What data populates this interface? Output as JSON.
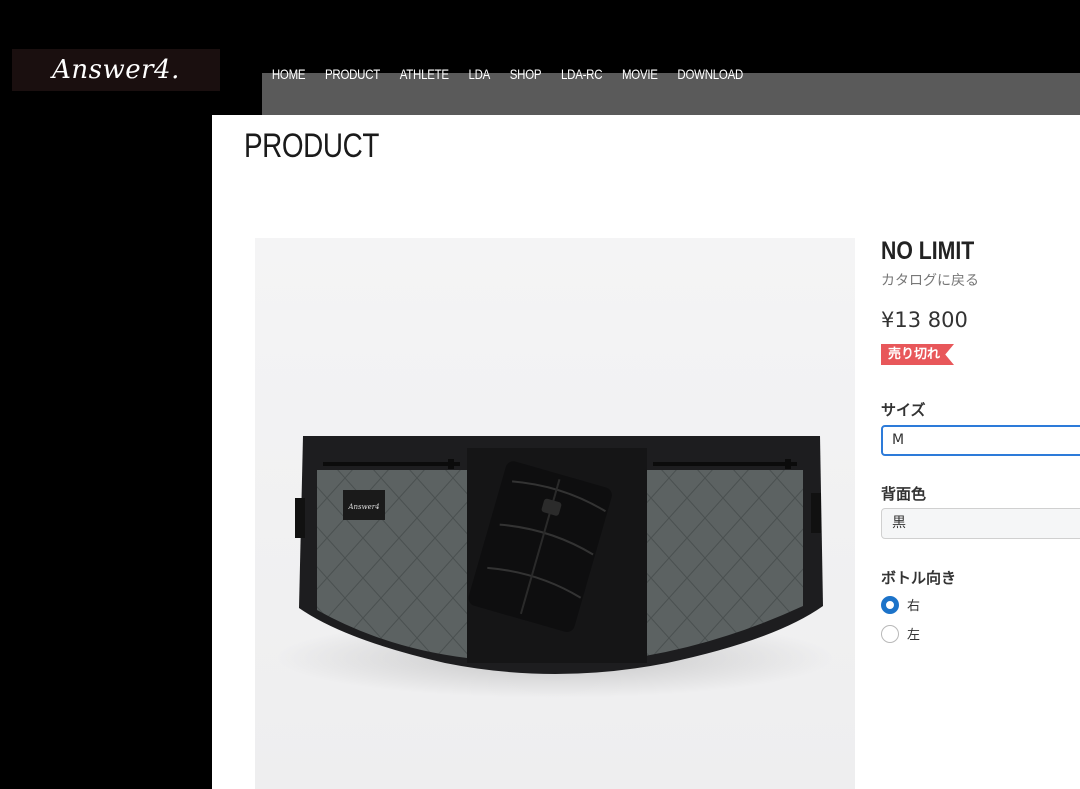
{
  "header": {
    "logo": "Answer4.",
    "nav": [
      "HOME",
      "PRODUCT",
      "ATHLETE",
      "LDA",
      "SHOP",
      "LDA-RC",
      "MOVIE",
      "DOWNLOAD"
    ]
  },
  "page": {
    "title": "PRODUCT"
  },
  "product": {
    "name": "NO LIMIT",
    "back_link": "カタログに戻る",
    "price": "¥13 800",
    "badge": "売り切れ",
    "image_patch_label": "Answer4",
    "size": {
      "label": "サイズ",
      "value": "M"
    },
    "back_color": {
      "label": "背面色",
      "value": "黒"
    },
    "bottle_direction": {
      "label": "ボトル向き",
      "options": [
        {
          "label": "右",
          "checked": true
        },
        {
          "label": "左",
          "checked": false
        }
      ]
    }
  },
  "colors": {
    "accent": "#1c73c9",
    "badge": "#e8575a",
    "nav_bar": "#5a5a5a"
  }
}
